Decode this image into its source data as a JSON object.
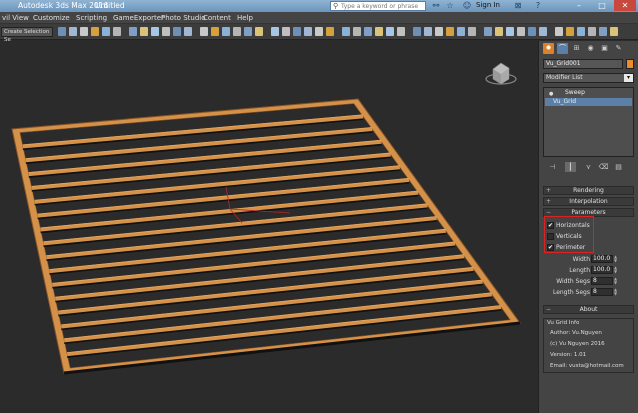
{
  "titlebar": {
    "app_title": "Autodesk 3ds Max 2016",
    "doc_title": "Untitled",
    "search_placeholder": "Type a keyword or phrase",
    "signin_label": "Sign In"
  },
  "menubar": {
    "items": [
      "vil View",
      "Customize",
      "Scripting",
      "GameExporter",
      "Photo Studio",
      "Content",
      "Help"
    ]
  },
  "toolbar": {
    "selection_set": "Create Selection Se"
  },
  "command_panel": {
    "object_name": "Vu_Grid001",
    "object_color": "#e88c2c",
    "modifier_list": "Modifier List",
    "stack": [
      "Sweep",
      "Vu_Grid"
    ],
    "rollouts": {
      "rendering": "Rendering",
      "interpolation": "Interpolation",
      "parameters": "Parameters",
      "about": "About"
    },
    "checkboxes": [
      {
        "label": "Horizontals",
        "checked": true
      },
      {
        "label": "Verticals",
        "checked": false
      },
      {
        "label": "Perimeter",
        "checked": true
      }
    ],
    "params": [
      {
        "label": "Width",
        "value": "100.0"
      },
      {
        "label": "Length",
        "value": "100.0"
      },
      {
        "label": "Width Segs",
        "value": "8"
      },
      {
        "label": "Length Segs",
        "value": "8"
      }
    ],
    "about_title": "Vu Grid Info",
    "about_lines": [
      "Author: Vu.Nguyen",
      "(c) Vu Nguyen 2016",
      "Version: 1.01",
      "Email: vusta@hotmail.com"
    ]
  },
  "colors": {
    "wood": "#d4914a",
    "highlight": "#dd2222"
  }
}
